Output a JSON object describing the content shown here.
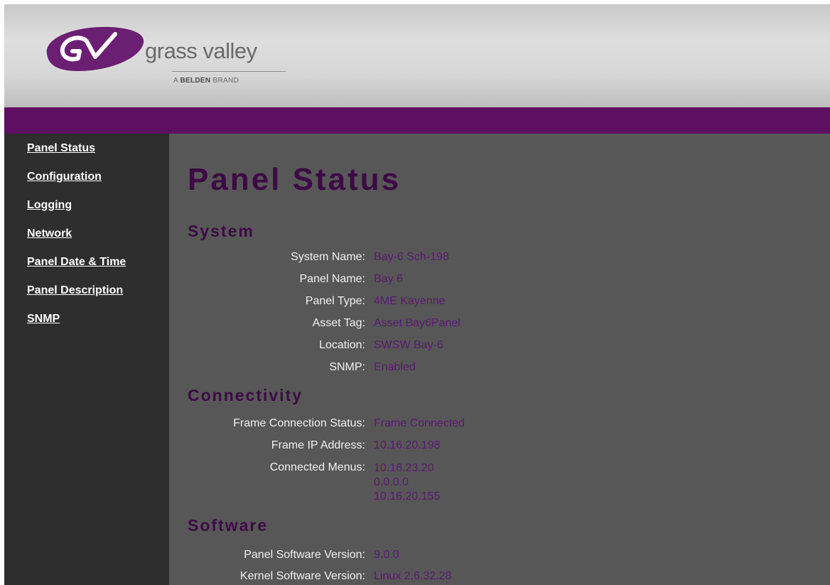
{
  "brand": {
    "name": "grass valley",
    "tagline_prefix": "A",
    "tagline_bold": "BELDEN",
    "tagline_suffix": "BRAND",
    "logo_icon": "gv-logo-icon",
    "colors": {
      "purple": "#5f0f61",
      "logo": "#6b1f72"
    }
  },
  "sidebar": {
    "items": [
      {
        "label": "Panel Status"
      },
      {
        "label": "Configuration"
      },
      {
        "label": "Logging"
      },
      {
        "label": "Network"
      },
      {
        "label": "Panel Date & Time"
      },
      {
        "label": "Panel Description"
      },
      {
        "label": "SNMP"
      }
    ]
  },
  "main": {
    "title": "Panel Status",
    "system": {
      "heading": "System",
      "rows": [
        {
          "label": "System Name:",
          "value": "Bay-6 Sch-198"
        },
        {
          "label": "Panel Name:",
          "value": "Bay 6"
        },
        {
          "label": "Panel Type:",
          "value": "4ME Kayenne"
        },
        {
          "label": "Asset Tag:",
          "value": "Asset Bay6Panel"
        },
        {
          "label": "Location:",
          "value": "SWSW Bay-6"
        },
        {
          "label": "SNMP:",
          "value": "Enabled"
        }
      ]
    },
    "connectivity": {
      "heading": "Connectivity",
      "rows": [
        {
          "label": "Frame Connection Status:",
          "value": "Frame Connected"
        },
        {
          "label": "Frame IP Address:",
          "value": "10.16.20.198"
        },
        {
          "label": "Connected Menus:",
          "values": [
            "10.16.23.20",
            "0.0.0.0",
            "10.16.20.155"
          ]
        }
      ]
    },
    "software": {
      "heading": "Software",
      "rows": [
        {
          "label": "Panel Software Version:",
          "value": "9.0.0"
        },
        {
          "label": "Kernel Software Version:",
          "value": "Linux 2.6.32.28"
        }
      ]
    }
  }
}
